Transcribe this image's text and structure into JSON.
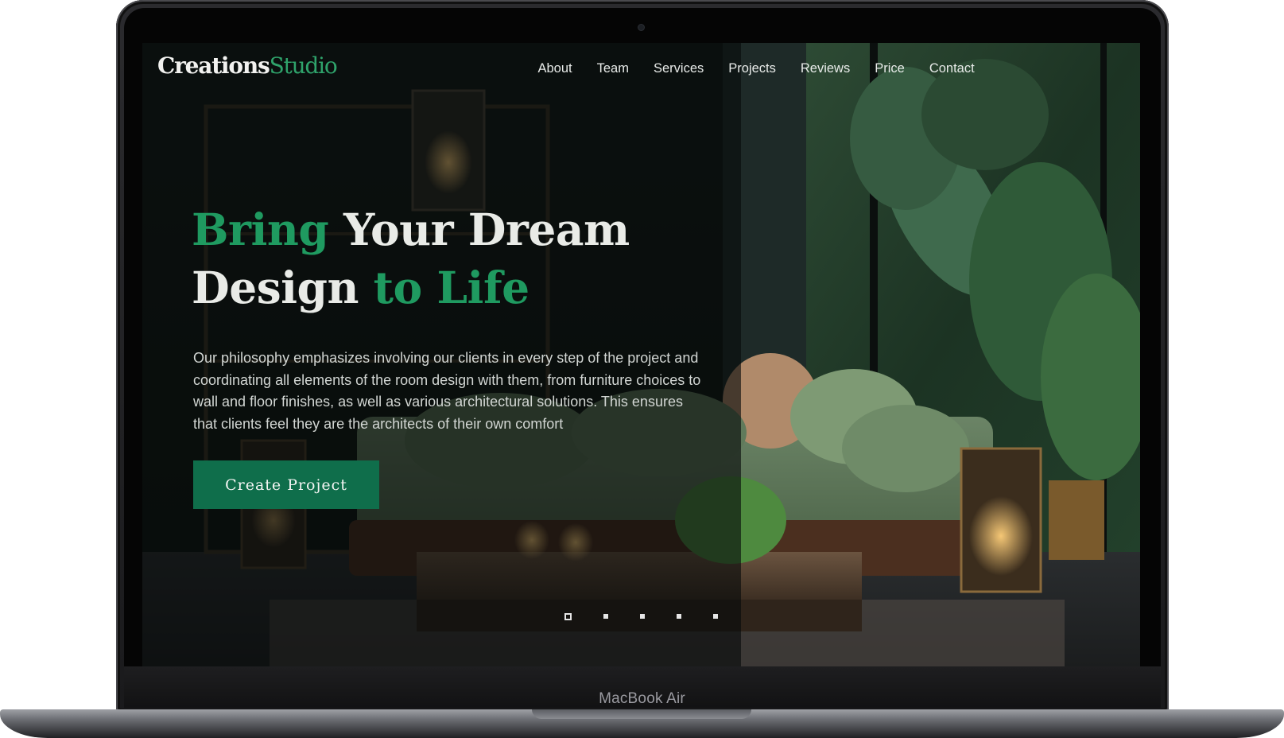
{
  "brand": {
    "name_part1": "Creations",
    "name_part2": "Studio"
  },
  "nav": {
    "items": [
      {
        "label": "About"
      },
      {
        "label": "Team"
      },
      {
        "label": "Services"
      },
      {
        "label": "Projects"
      },
      {
        "label": "Reviews"
      },
      {
        "label": "Price"
      },
      {
        "label": "Contact"
      }
    ]
  },
  "hero": {
    "title_part1": "Bring",
    "title_part2": " Your Dream",
    "title_part3": "Design ",
    "title_part4": "to Life",
    "description": "Our philosophy emphasizes involving our clients in every step of the project and coordinating all elements of the room design with them, from furniture choices to wall and floor finishes, as well as various architectural solutions. This ensures that clients feel they are the architects of their own comfort",
    "cta_label": "Create Project"
  },
  "slider": {
    "count": 5,
    "active_index": 0
  },
  "device": {
    "label": "MacBook Air"
  },
  "colors": {
    "accent": "#1f9a60",
    "button_bg": "#0f6e4b",
    "text_light": "#e9ebe7"
  }
}
